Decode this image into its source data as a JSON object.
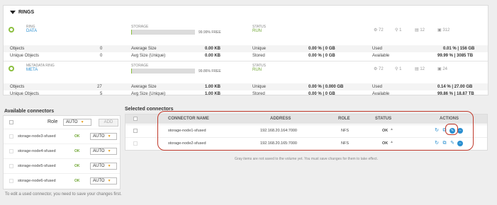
{
  "rings": {
    "title": "RINGS",
    "ring1": {
      "label": "RING",
      "name": "DATA",
      "storage_label": "STORAGE",
      "storage_fill": 0.0001,
      "free_text": "99.99% FREE",
      "status_label": "STATUS",
      "status_value": "RUN",
      "stats": [
        {
          "icon": "gear-icon",
          "value": "72"
        },
        {
          "icon": "pin-icon",
          "value": "1"
        },
        {
          "icon": "server-icon",
          "value": "12"
        },
        {
          "icon": "disk-icon",
          "value": "312"
        }
      ],
      "rows": [
        {
          "c1": "Objects",
          "v1": "0",
          "c2": "Average Size",
          "v2": "0.00 KB",
          "c3": "Unique",
          "v3": "0.00 % | 0 GB",
          "c4": "Used",
          "v4": "0.01 % | 156 GB"
        },
        {
          "c1": "Unique Objects",
          "v1": "0",
          "c2": "Avg Size (Unique)",
          "v2": "0.00 KB",
          "c3": "Stored",
          "v3": "0.00 % | 0 GB",
          "c4": "Available",
          "v4": "99.99 % | 3085 TB"
        }
      ]
    },
    "ring2": {
      "label": "METADATA RING",
      "name": "META",
      "storage_label": "STORAGE",
      "storage_fill": 0.0014,
      "free_text": "99.86% FREE",
      "status_label": "STATUS",
      "status_value": "RUN",
      "stats": [
        {
          "icon": "gear-icon",
          "value": "72"
        },
        {
          "icon": "pin-icon",
          "value": "1"
        },
        {
          "icon": "server-icon",
          "value": "12"
        },
        {
          "icon": "disk-icon",
          "value": "24"
        }
      ],
      "rows": [
        {
          "c1": "Objects",
          "v1": "27",
          "c2": "Average Size",
          "v2": "1.00 KB",
          "c3": "Unique",
          "v3": "0.00 % | 0.000 GB",
          "c4": "Used",
          "v4": "0.14 % | 27.00 GB"
        },
        {
          "c1": "Unique Objects",
          "v1": "5",
          "c2": "Avg Size (Unique)",
          "v2": "1.00 KB",
          "c3": "Stored",
          "v3": "0.00 % | 0 GB",
          "c4": "Available",
          "v4": "99.86 % | 18.87 TB"
        }
      ]
    }
  },
  "available": {
    "title": "Available connectors",
    "role_label": "Role",
    "role_value": "AUTO",
    "add_label": "ADD",
    "items": [
      {
        "name": "storage-node3-sfused",
        "status": "OK",
        "role": "AUTO"
      },
      {
        "name": "storage-node4-sfused",
        "status": "OK",
        "role": "AUTO"
      },
      {
        "name": "storage-node5-sfused",
        "status": "OK",
        "role": "AUTO"
      },
      {
        "name": "storage-node6-sfused",
        "status": "OK",
        "role": "AUTO"
      }
    ],
    "note": "To edit a used connector, you need to save your changes first."
  },
  "selected": {
    "title": "Selected connectors",
    "headers": {
      "name": "CONNECTOR NAME",
      "address": "ADDRESS",
      "role": "ROLE",
      "status": "STATUS",
      "actions": "ACTIONS"
    },
    "rows": [
      {
        "name": "storage-node1-sfused",
        "address": "192.168.20.164:7000",
        "role": "NFS",
        "status": "OK"
      },
      {
        "name": "storage-node2-sfused",
        "address": "192.168.20.165:7000",
        "role": "NFS",
        "status": "OK"
      }
    ],
    "note": "Gray items are not saved to the volume yet. You must save changes for them to take effect."
  },
  "colors": {
    "accent": "#2a8fd0",
    "ok": "#6ea531",
    "highlight": "#c0392b"
  }
}
